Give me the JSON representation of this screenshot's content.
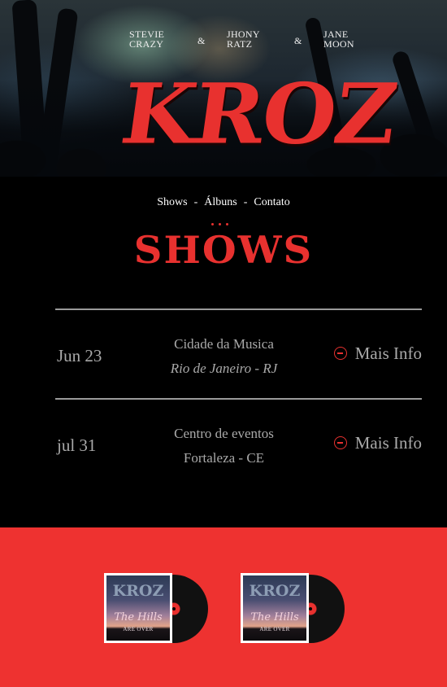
{
  "hero": {
    "members": [
      {
        "first": "STEVIE",
        "last": "CRAZY"
      },
      {
        "first": "JHONY",
        "last": "RATZ"
      },
      {
        "first": "JANE",
        "last": "MOON"
      }
    ],
    "separator": "&",
    "logo": "KROZ"
  },
  "nav": {
    "items": [
      "Shows",
      "Álbuns",
      "Contato"
    ],
    "separator": "-"
  },
  "section_title": "SHOWS",
  "shows": [
    {
      "date": "Jun 23",
      "place": "Cidade da Musica",
      "city": "Rio de Janeiro - RJ",
      "action": "Mais Info"
    },
    {
      "date": "jul 31",
      "place": "Centro de eventos",
      "city": "Fortaleza - CE",
      "action": "Mais Info"
    }
  ],
  "albums": [
    {
      "band": "KROZ",
      "title": "The Hills",
      "subtitle": "ARE OVER"
    },
    {
      "band": "KROZ",
      "title": "The Hills",
      "subtitle": "ARE OVER"
    }
  ],
  "colors": {
    "accent": "#e8312f",
    "text_muted": "#a9a9a9",
    "albums_bg": "#ee3230"
  }
}
